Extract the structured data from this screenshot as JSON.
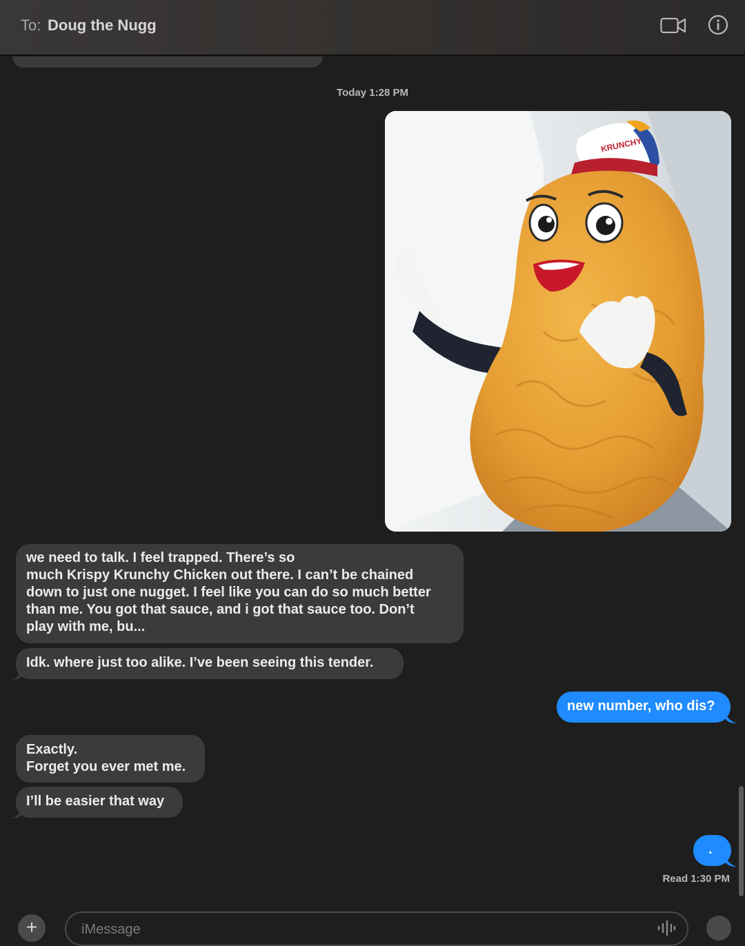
{
  "header": {
    "to_label": "To:",
    "recipient": "Doug the Nugg",
    "video_icon": "video-camera-icon",
    "info_icon": "info-icon"
  },
  "conversation": {
    "timestamp": "Today 1:28 PM",
    "photo_description_icon": "photo-attachment",
    "photo_cap_text": "KRUNCHY",
    "messages": [
      {
        "direction": "incoming",
        "lines": [
          "we need to talk. I feel trapped. There’s so",
          "much Krispy Krunchy Chicken out there. I can’t be chained",
          "down to just one nugget. I feel like you can do so much better",
          "than me. You got that sauce, and i got that sauce too. Don’t",
          "play with me, bu..."
        ]
      },
      {
        "direction": "incoming",
        "lines": [
          "Idk. where just too alike. I’ve been seeing this tender."
        ]
      },
      {
        "direction": "outgoing",
        "lines": [
          "new number, who dis?"
        ]
      },
      {
        "direction": "incoming",
        "lines": [
          "Exactly.",
          "Forget you ever met me."
        ]
      },
      {
        "direction": "incoming",
        "lines": [
          "I’ll be easier that way"
        ]
      },
      {
        "direction": "outgoing",
        "lines": [
          "."
        ]
      }
    ],
    "read_receipt": "Read 1:30 PM"
  },
  "composer": {
    "placeholder": "iMessage",
    "plus_label": "+",
    "audio_icon": "audio-waveform-icon",
    "emoji_icon": "emoji-icon"
  },
  "colors": {
    "background": "#1e1e1e",
    "incoming_bubble": "#3b3b3d",
    "outgoing_bubble": "#1f8bff"
  }
}
